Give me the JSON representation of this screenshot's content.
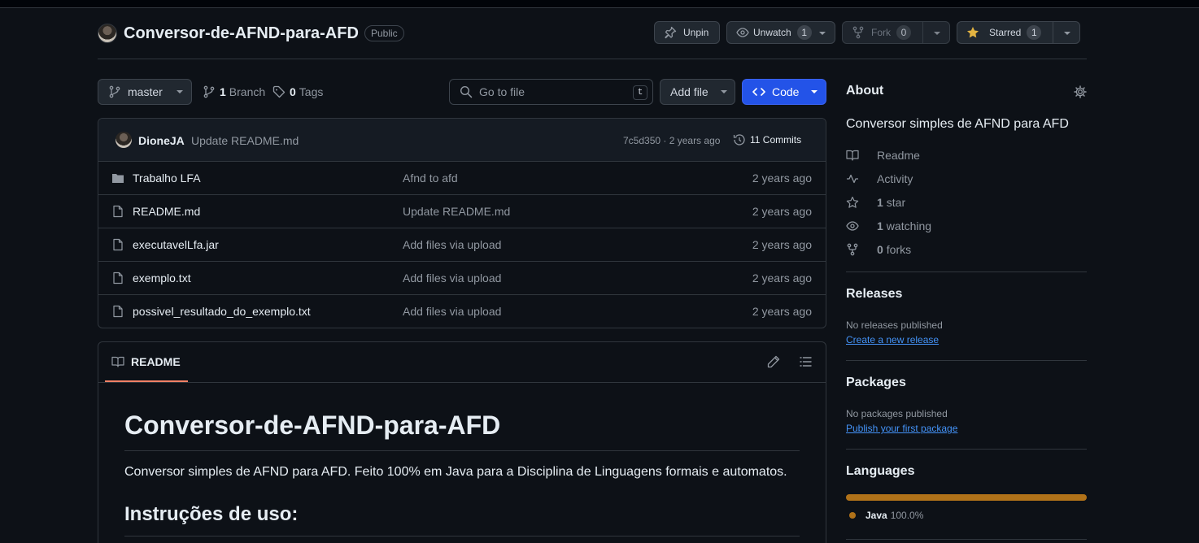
{
  "repo": {
    "name": "Conversor-de-AFND-para-AFD",
    "visibility": "Public"
  },
  "actions": {
    "unpin": "Unpin",
    "unwatch": "Unwatch",
    "watch_count": "1",
    "fork": "Fork",
    "fork_count": "0",
    "starred": "Starred",
    "star_count": "1"
  },
  "toolbar": {
    "branch": "master",
    "branches_count": "1",
    "branches_label": "Branch",
    "tags_count": "0",
    "tags_label": "Tags",
    "search_placeholder": "Go to file",
    "search_shortcut": "t",
    "add_file": "Add file",
    "code": "Code"
  },
  "latest_commit": {
    "author": "DioneJA",
    "message": "Update README.md",
    "meta": "7c5d350 · 2 years ago",
    "commits": "11 Commits"
  },
  "files": [
    {
      "name": "Trabalho LFA",
      "type": "folder",
      "message": "Afnd to afd",
      "age": "2 years ago"
    },
    {
      "name": "README.md",
      "type": "file",
      "message": "Update README.md",
      "age": "2 years ago"
    },
    {
      "name": "executavelLfa.jar",
      "type": "file",
      "message": "Add files via upload",
      "age": "2 years ago"
    },
    {
      "name": "exemplo.txt",
      "type": "file",
      "message": "Add files via upload",
      "age": "2 years ago"
    },
    {
      "name": "possivel_resultado_do_exemplo.txt",
      "type": "file",
      "message": "Add files via upload",
      "age": "2 years ago"
    }
  ],
  "readme": {
    "tab": "README",
    "title": "Conversor-de-AFND-para-AFD",
    "paragraph": "Conversor simples de AFND para AFD. Feito 100% em Java para a Disciplina de Linguagens formais e automatos.",
    "subtitle": "Instruções de uso:"
  },
  "about": {
    "heading": "About",
    "description": "Conversor simples de AFND para AFD",
    "readme": "Readme",
    "activity": "Activity",
    "stars_count": "1",
    "stars_label": "star",
    "watching_count": "1",
    "watching_label": "watching",
    "forks_count": "0",
    "forks_label": "forks"
  },
  "releases": {
    "heading": "Releases",
    "empty": "No releases published",
    "link": "Create a new release"
  },
  "packages": {
    "heading": "Packages",
    "empty": "No packages published",
    "link": "Publish your first package"
  },
  "languages": {
    "heading": "Languages",
    "items": [
      {
        "name": "Java",
        "percent": "100.0%",
        "color": "#b07219"
      }
    ]
  },
  "colors": {
    "accent_blue": "#2353e8",
    "link": "#4493f8",
    "tab_underline": "#f78166",
    "star": "#e3b341"
  }
}
